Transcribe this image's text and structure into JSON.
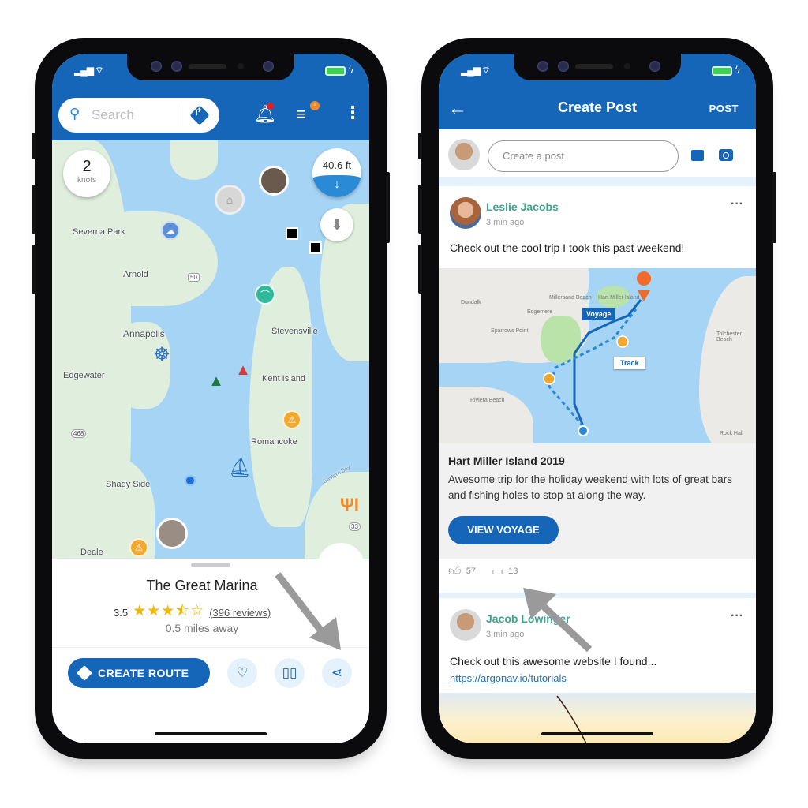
{
  "left_phone": {
    "status": {
      "signal_icon": "signal-bars-icon",
      "wifi_icon": "wifi-icon",
      "battery_icon": "battery-charging-icon"
    },
    "search": {
      "placeholder": "Search",
      "search_icon": "search-icon",
      "route_icon": "directions-diamond-icon"
    },
    "toolbar": {
      "notification_icon": "bell-icon",
      "filter_icon": "filter-icon",
      "filter_badge": "!",
      "menu_icon": "more-vertical-icon"
    },
    "map": {
      "speed": {
        "value": "2",
        "unit": "knots"
      },
      "depth": {
        "value": "40.6 ft",
        "icon": "arrow-down-icon"
      },
      "labels": [
        "Severna Park",
        "Arnold",
        "Annapolis",
        "Stevensville",
        "Edgewater",
        "Kent Island",
        "Romancoke",
        "Shady Side",
        "Deale",
        "Eastern Bay"
      ],
      "route_shields": [
        "50",
        "468",
        "33"
      ],
      "markers": [
        "marina-icon",
        "user-avatar",
        "weather-icon",
        "location-pin-icon",
        "fish-icon",
        "helm-icon",
        "green-buoy-icon",
        "red-buoy-icon",
        "hazard-icon",
        "sailboat-icon",
        "current-location-dot",
        "restaurant-icon",
        "hazard-icon",
        "user-avatar"
      ]
    },
    "sheet": {
      "title": "The Great Marina",
      "rating_value": "3.5",
      "rating": 3.5,
      "rating_max": 5,
      "stars": "★★★⯪☆",
      "reviews": "(396 reviews)",
      "distance": "0.5 miles away",
      "create_route_label": "CREATE ROUTE",
      "favorite_icon": "heart-icon",
      "guide_icon": "book-icon",
      "share_icon": "share-icon"
    }
  },
  "right_phone": {
    "header": {
      "back_icon": "arrow-left-icon",
      "title": "Create Post",
      "action": "POST"
    },
    "composer": {
      "placeholder": "Create a post",
      "image_icon": "image-icon",
      "camera_icon": "camera-icon"
    },
    "posts": [
      {
        "author": "Leslie Jacobs",
        "time": "3 min ago",
        "text": "Check out the cool trip I took this past weekend!",
        "map": {
          "labels": [
            "Dundalk",
            "Edgemere",
            "Sparrows Point",
            "Millersand Beach",
            "Hart Miller Island",
            "Tolchester Beach",
            "Rock Hall",
            "Riviera Beach"
          ],
          "voyage_tag": "Voyage",
          "track_tag": "Track"
        },
        "voyage_title": "Hart Miller Island 2019",
        "voyage_desc": "Awesome trip for the holiday weekend with lots of great bars and fishing holes to stop at along the way.",
        "button": "VIEW VOYAGE",
        "likes": "57",
        "comments": "13"
      },
      {
        "author": "Jacob Lowinger",
        "time": "3 min ago",
        "text": "Check out this awesome website I found...",
        "link": "https://argonav.io/tutorials"
      }
    ]
  },
  "colors": {
    "primary": "#1565b8",
    "author_green": "#3aa58c",
    "star": "#f5b800",
    "water": "#a6d4f5",
    "hazard": "#f0a830"
  }
}
